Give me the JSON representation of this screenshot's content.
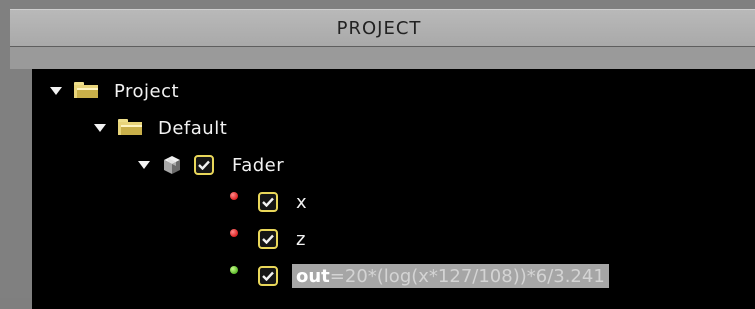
{
  "panel": {
    "title": "PROJECT",
    "accent_color": "#2fc42f"
  },
  "tree": {
    "project": {
      "label": "Project",
      "icon": "folder-icon",
      "expanded": true
    },
    "default": {
      "label": "Default",
      "icon": "folder-icon",
      "expanded": true
    },
    "fader": {
      "label": "Fader",
      "icon": "cube-icon",
      "checked": true,
      "expanded": true
    },
    "channels": [
      {
        "label": "x",
        "status": "red",
        "checked": true
      },
      {
        "label": "z",
        "status": "red",
        "checked": true
      }
    ],
    "output": {
      "status": "green",
      "checked": true,
      "name": "out",
      "expression": "=20*(log(x*127/108))*6/3.241"
    }
  },
  "colors": {
    "status_red": "#dd2222",
    "status_green": "#5ab82a",
    "checkbox_border": "#e9d75a",
    "tree_background": "#000000"
  }
}
